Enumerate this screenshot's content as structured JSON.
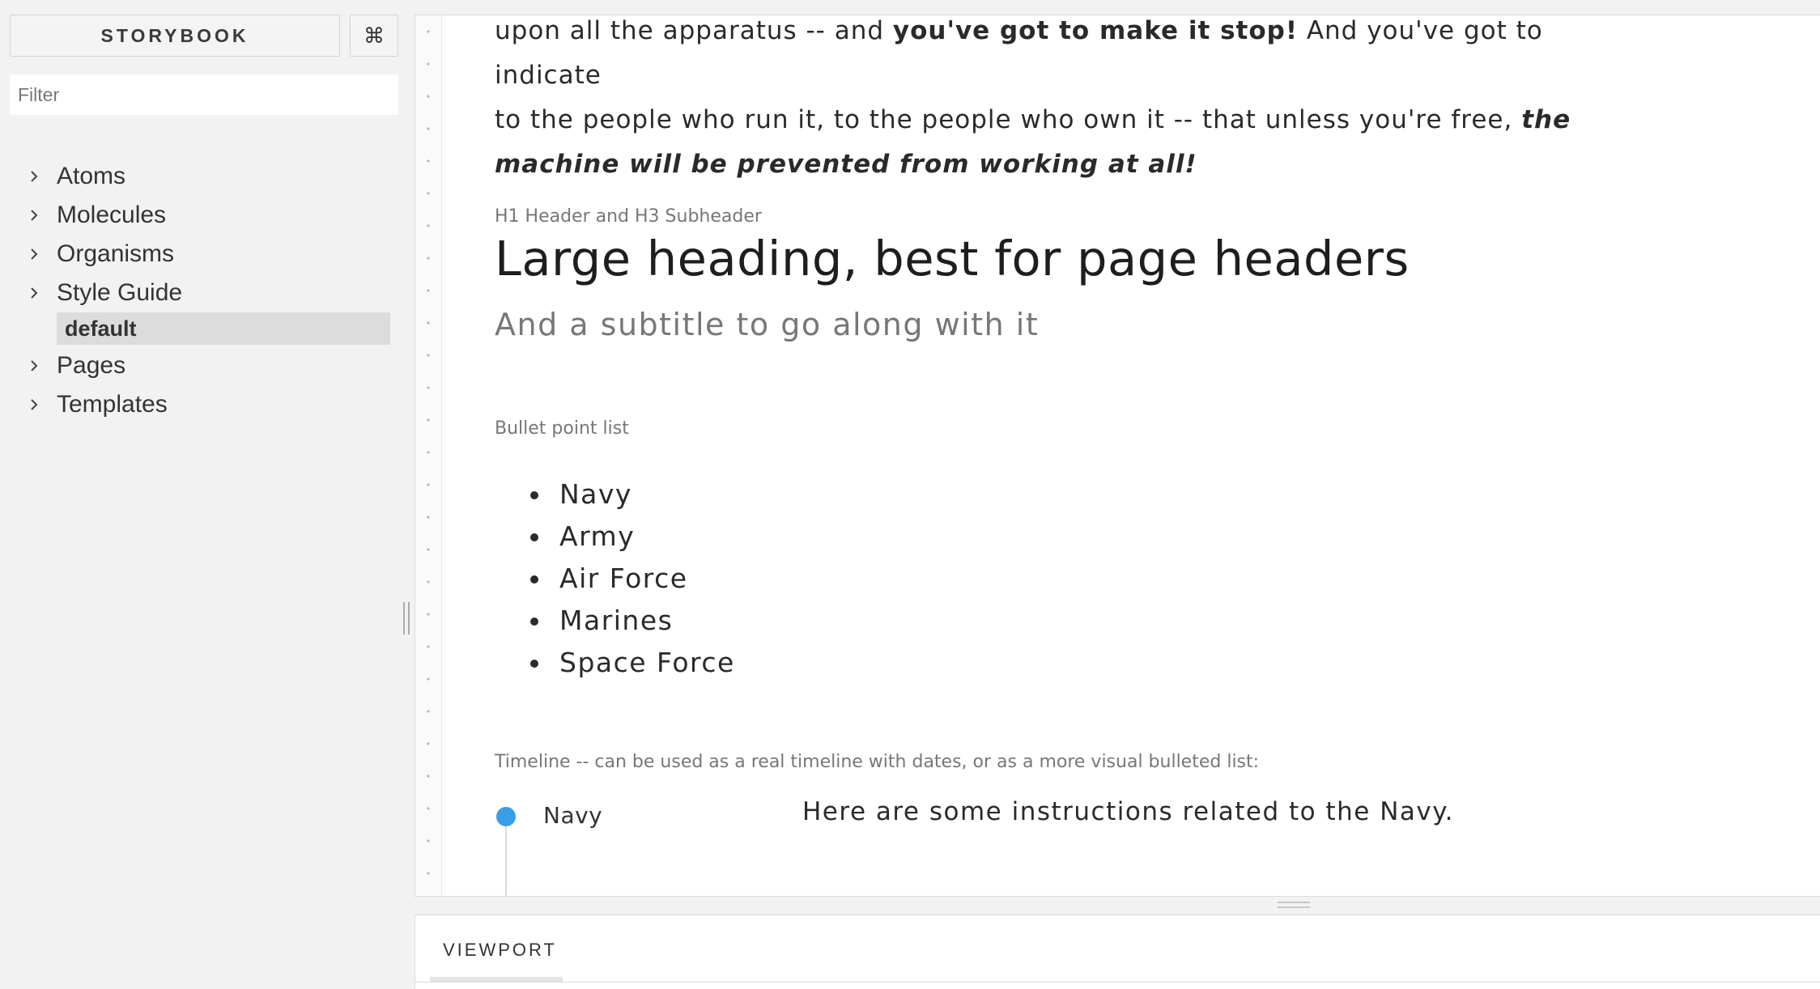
{
  "sidebar": {
    "brand": "STORYBOOK",
    "shortcut_icon": "⌘",
    "filter_placeholder": "Filter",
    "items": [
      {
        "label": "Atoms"
      },
      {
        "label": "Molecules"
      },
      {
        "label": "Organisms"
      },
      {
        "label": "Style Guide",
        "expanded": true,
        "children": [
          {
            "label": "default",
            "selected": true
          }
        ]
      },
      {
        "label": "Pages"
      },
      {
        "label": "Templates"
      }
    ]
  },
  "preview": {
    "paragraph": {
      "line1_a": "upon all the apparatus -- and ",
      "line1_b": "you've got to make it stop!",
      "line1_c": " And you've got to indicate",
      "line2_a": "to the people who run it, to the people who own it -- that unless you're free, ",
      "line2_b": "the",
      "line3": "machine will be prevented from working at all!"
    },
    "heading_section": {
      "label": "H1 Header and H3 Subheader",
      "h1": "Large heading, best for page headers",
      "h3": "And a subtitle to go along with it"
    },
    "bullet_section": {
      "label": "Bullet point list",
      "items": [
        "Navy",
        "Army",
        "Air Force",
        "Marines",
        "Space Force"
      ]
    },
    "timeline_section": {
      "label": "Timeline -- can be used as a real timeline with dates, or as a more visual bulleted list:",
      "entries": [
        {
          "title": "Navy",
          "text": "Here are some instructions related to the Navy."
        }
      ],
      "accent_color": "#3a9de8"
    }
  },
  "addons": {
    "tabs": [
      "VIEWPORT"
    ]
  }
}
